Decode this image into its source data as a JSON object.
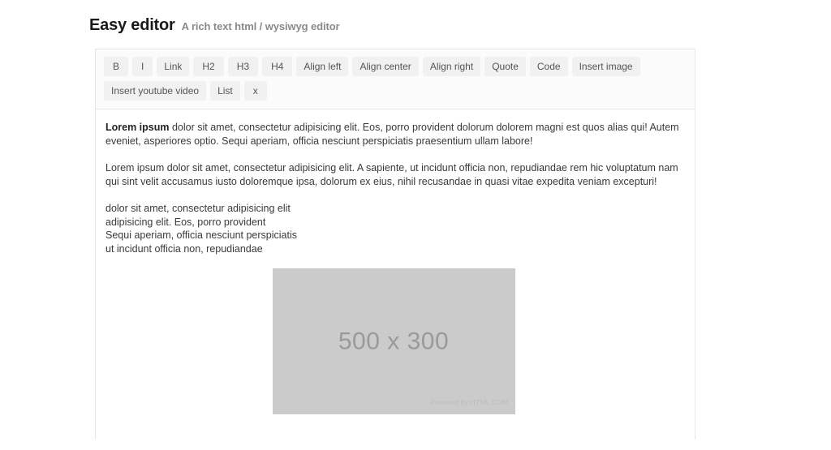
{
  "header": {
    "title": "Easy editor",
    "subtitle": "A rich text html / wysiwyg editor"
  },
  "toolbar": {
    "buttons": [
      {
        "label": "B",
        "name": "bold-button"
      },
      {
        "label": "I",
        "name": "italic-button"
      },
      {
        "label": "Link",
        "name": "link-button"
      },
      {
        "label": "H2",
        "name": "heading2-button"
      },
      {
        "label": "H3",
        "name": "heading3-button"
      },
      {
        "label": "H4",
        "name": "heading4-button"
      },
      {
        "label": "Align left",
        "name": "align-left-button"
      },
      {
        "label": "Align center",
        "name": "align-center-button"
      },
      {
        "label": "Align right",
        "name": "align-right-button"
      },
      {
        "label": "Quote",
        "name": "quote-button"
      },
      {
        "label": "Code",
        "name": "code-button"
      },
      {
        "label": "Insert image",
        "name": "insert-image-button"
      },
      {
        "label": "Insert youtube video",
        "name": "insert-youtube-video-button"
      },
      {
        "label": "List",
        "name": "list-button"
      },
      {
        "label": "x",
        "name": "clear-formatting-button"
      }
    ]
  },
  "content": {
    "paragraph1_strong": "Lorem ipsum",
    "paragraph1_rest": " dolor sit amet, consectetur adipisicing elit. Eos, porro provident dolorum dolorem magni est quos alias qui! Autem eveniet, asperiores optio. Sequi aperiam, officia nesciunt perspiciatis praesentium ullam labore!",
    "paragraph2": "Lorem ipsum dolor sit amet, consectetur adipisicing elit. A sapiente, ut incidunt officia non, repudiandae rem hic voluptatum nam qui sint velit accusamus iusto doloremque ipsa, dolorum ex eius, nihil recusandae in quasi vitae expedita veniam excepturi!",
    "short_lines": [
      "dolor sit amet, consectetur adipisicing elit",
      "adipisicing elit. Eos, porro provident",
      "Sequi aperiam, officia nesciunt perspiciatis",
      "ut incidunt officia non, repudiandae"
    ],
    "image": {
      "label": "500 x 300",
      "credit": "Powered by HTML.COM"
    }
  },
  "colors": {
    "page_background": "#ffffff",
    "toolbar_background": "#fbfbfb",
    "button_background": "#f1f1f1",
    "border": "#e6e6e6",
    "text": "#3a3a3a",
    "muted_text": "#8a8a8a",
    "placeholder_fill": "#cbcbcb",
    "placeholder_text": "#9a9a9a"
  }
}
